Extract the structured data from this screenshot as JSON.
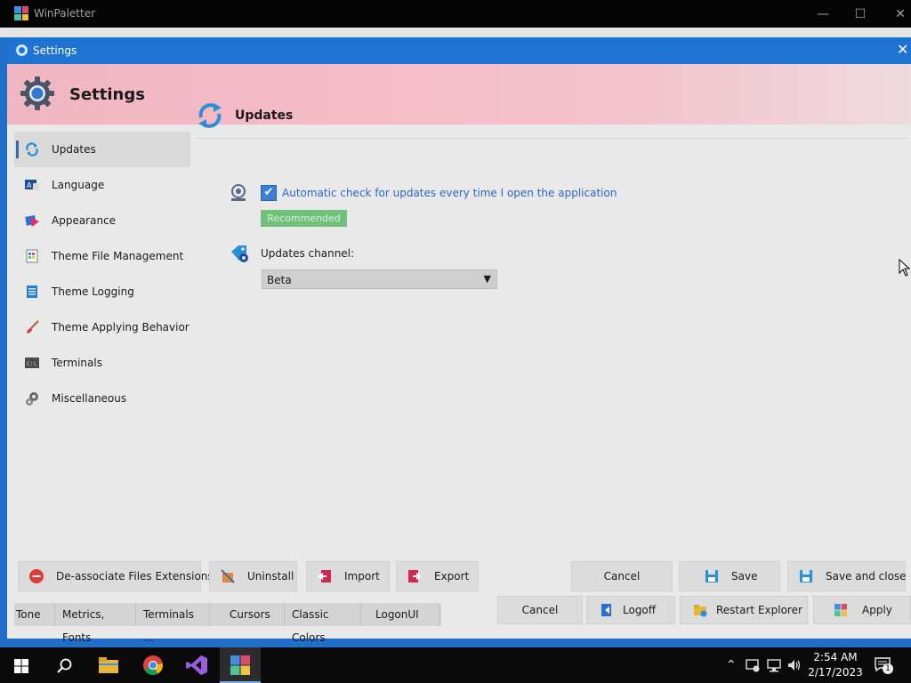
{
  "outer_window": {
    "title": "WinPaletter",
    "minimize_glyph": "—",
    "maximize_glyph": "☐",
    "close_glyph": "✕"
  },
  "settings_window": {
    "title": "Settings",
    "close_glyph": "✕",
    "header_title": "Settings",
    "header_gradient": [
      "#f0b6c2",
      "#eedbdf"
    ]
  },
  "sidebar": {
    "items": [
      {
        "label": "Updates",
        "icon": "updates-icon",
        "active": true
      },
      {
        "label": "Language",
        "icon": "language-icon"
      },
      {
        "label": "Appearance",
        "icon": "appearance-icon"
      },
      {
        "label": "Theme File Management",
        "icon": "theme-file-icon"
      },
      {
        "label": "Theme Logging",
        "icon": "theme-logging-icon"
      },
      {
        "label": "Theme Applying Behavior",
        "icon": "brush-icon"
      },
      {
        "label": "Terminals",
        "icon": "terminal-icon"
      },
      {
        "label": "Miscellaneous",
        "icon": "gears-icon"
      }
    ]
  },
  "content": {
    "title": "Updates",
    "auto_check": {
      "label": "Automatic check for updates every time I open the application",
      "checked": true,
      "check_glyph": "✔"
    },
    "recommended_badge": "Recommended",
    "channel": {
      "label": "Updates channel:",
      "selected": "Beta",
      "arrow_glyph": "⌄"
    }
  },
  "buttons": {
    "deassociate": "De-associate Files Extensions",
    "uninstall": "Uninstall",
    "import": "Import",
    "export": "Export",
    "cancel": "Cancel",
    "save": "Save",
    "save_close": "Save and close"
  },
  "background_tabs": [
    "Tone",
    "Metrics, Fonts",
    "Terminals ...",
    "Cursors",
    "Classic Colors",
    "LogonUI"
  ],
  "background_buttons": {
    "cancel": "Cancel",
    "logoff": "Logoff",
    "restart_explorer": "Restart Explorer",
    "apply": "Apply"
  },
  "taskbar": {
    "items": [
      "start-icon",
      "search-icon",
      "file-explorer-icon",
      "chrome-icon",
      "visual-studio-icon",
      "winpaletter-icon"
    ],
    "time": "2:54 AM",
    "date": "2/17/2023",
    "notification_count": "1"
  },
  "colors": {
    "accent_blue": "#1e74d0",
    "check_blue": "#3d7fd8",
    "recommended_green": "#6fc17b"
  }
}
